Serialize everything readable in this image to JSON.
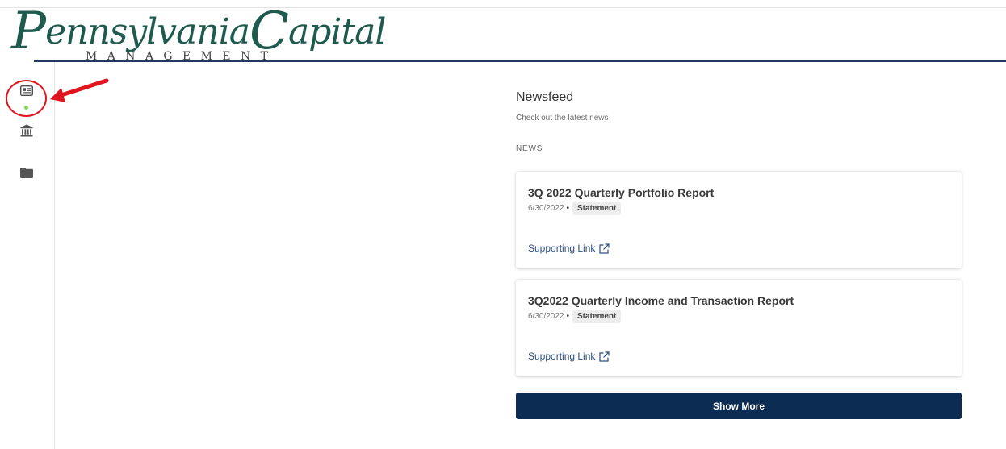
{
  "logo": {
    "initial_p": "P",
    "word_1": "ennsylvania",
    "initial_c": "C",
    "word_2": "apital",
    "subtitle": "MANAGEMENT"
  },
  "sidebar": {
    "items": [
      {
        "icon": "newspaper-icon",
        "active": true
      },
      {
        "icon": "bank-icon"
      },
      {
        "icon": "folder-icon"
      }
    ],
    "active_dot_color": "#7ed957"
  },
  "annotation": {
    "color": "#e0141f"
  },
  "newsfeed": {
    "title": "Newsfeed",
    "subtitle": "Check out the latest news",
    "section_label": "NEWS",
    "items": [
      {
        "title": "3Q 2022 Quarterly Portfolio Report",
        "date": "6/30/2022",
        "separator": "•",
        "tag": "Statement",
        "link_label": "Supporting Link",
        "link_icon": "external-link-icon"
      },
      {
        "title": "3Q2022 Quarterly Income and Transaction Report",
        "date": "6/30/2022",
        "separator": "•",
        "tag": "Statement",
        "link_label": "Supporting Link",
        "link_icon": "external-link-icon"
      }
    ],
    "show_more_label": "Show More"
  },
  "colors": {
    "brand_green": "#1f5a4e",
    "header_rule": "#24375d",
    "primary_button": "#0d2c54",
    "link": "#2c4f82"
  }
}
